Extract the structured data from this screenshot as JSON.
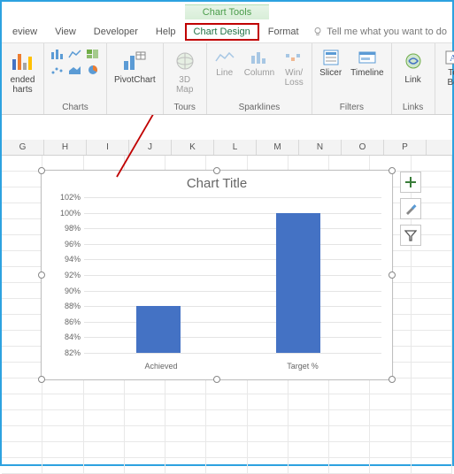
{
  "chart_tools_label": "Chart Tools",
  "tabs": {
    "review": "eview",
    "view": "View",
    "developer": "Developer",
    "help": "Help",
    "chart_design": "Chart Design",
    "format": "Format"
  },
  "tell_me": "Tell me what you want to do",
  "ribbon": {
    "charts": {
      "recommended": "ended\nharts",
      "group_label": "Charts"
    },
    "pivot": {
      "label": "PivotChart"
    },
    "tours": {
      "label": "3D\nMap",
      "group_label": "Tours"
    },
    "sparklines": {
      "line": "Line",
      "column": "Column",
      "winloss": "Win/\nLoss",
      "group_label": "Sparklines"
    },
    "filters": {
      "slicer": "Slicer",
      "timeline": "Timeline",
      "group_label": "Filters"
    },
    "links": {
      "link": "Link",
      "group_label": "Links"
    },
    "text": {
      "textbox": "Te\nBo"
    }
  },
  "columns": [
    "G",
    "H",
    "I",
    "J",
    "K",
    "L",
    "M",
    "N",
    "O",
    "P"
  ],
  "chart_data": {
    "type": "bar",
    "title": "Chart Title",
    "categories": [
      "Achieved",
      "Target %"
    ],
    "values": [
      0.88,
      1.0
    ],
    "ylabel": "",
    "xlabel": "",
    "ylim": [
      0.82,
      1.02
    ],
    "yticks": [
      "102%",
      "100%",
      "98%",
      "96%",
      "94%",
      "92%",
      "90%",
      "88%",
      "86%",
      "84%",
      "82%"
    ]
  },
  "side_buttons": {
    "plus": "+",
    "brush": "brush",
    "filter": "filter"
  }
}
